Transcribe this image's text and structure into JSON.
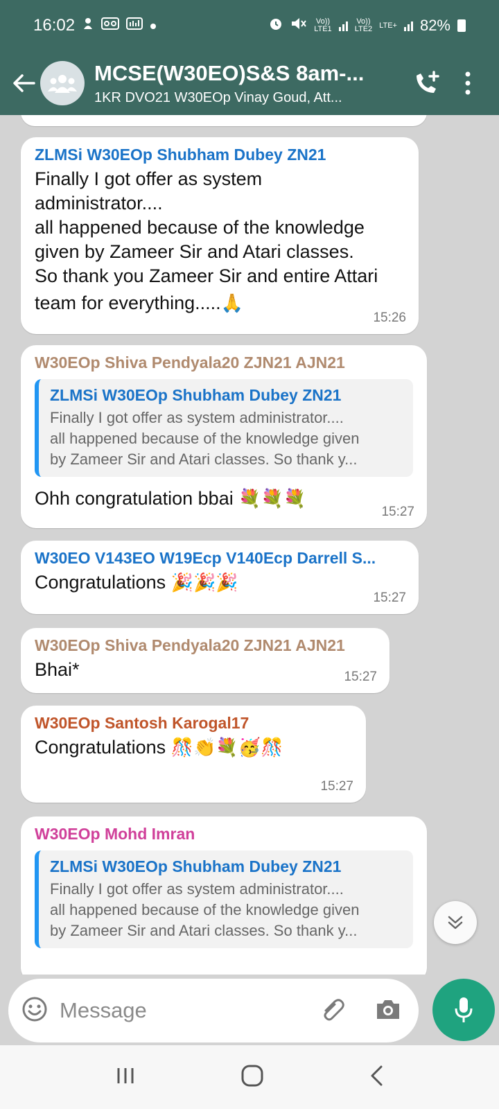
{
  "status_bar": {
    "time": "16:02",
    "sim1_label_top": "Vo))",
    "sim1_label_bottom": "LTE1",
    "sim2_label_top": "Vo))",
    "sim2_label_bottom": "LTE2",
    "network_type": "LTE+",
    "battery": "82%",
    "icons": [
      "notification-icon",
      "voicemail-icon",
      "signal-booster-icon",
      "dot-icon",
      "alarm-icon",
      "mute-icon",
      "signal-icon",
      "battery-icon"
    ]
  },
  "header": {
    "title": "MCSE(W30EO)S&S 8am-...",
    "subtitle": "1KR DVO21 W30EOp Vinay Goud, Att...",
    "icons": [
      "back-arrow-icon",
      "group-avatar-icon",
      "add-call-icon",
      "more-options-icon"
    ],
    "colors": {
      "header_bg": "#3d6a62"
    }
  },
  "messages": [
    {
      "sender": "ZLMSi W30EOp Shubham Dubey ZN21",
      "sender_color": "#1a73c8",
      "lines": [
        "Finally I got offer as system",
        "administrator....",
        "all happened because of the knowledge",
        "given by Zameer  Sir and Atari classes.",
        "So thank you Zameer Sir and entire Attari",
        "team for everything....."
      ],
      "emoji": "🙏",
      "time": "15:26"
    },
    {
      "sender": "W30EOp Shiva Pendyala20 ZJN21 AJN21",
      "sender_color": "#b08a6e",
      "quote": {
        "sender": "ZLMSi W30EOp Shubham Dubey ZN21",
        "lines": [
          "Finally I got offer as system administrator....",
          "all happened because of the knowledge given",
          "by Zameer  Sir and Atari classes. So thank y..."
        ]
      },
      "text": "Ohh congratulation bbai",
      "emoji": "💐💐💐",
      "time": "15:27"
    },
    {
      "sender": "W30EO V143EO W19Ecp V140Ecp Darrell S...",
      "sender_color": "#1a73c8",
      "text": "Congratulations",
      "emoji": "🎉🎉🎉",
      "time": "15:27"
    },
    {
      "sender": "W30EOp Shiva Pendyala20 ZJN21 AJN21",
      "sender_color": "#b08a6e",
      "text": "Bhai*",
      "time": "15:27"
    },
    {
      "sender": "W30EOp Santosh Karogal17",
      "sender_color": "#c0552a",
      "text": "Congratulations",
      "emoji": "🎊👏💐🥳🎊",
      "time": "15:27"
    },
    {
      "sender": "W30EOp Mohd Imran",
      "sender_color": "#d0409a",
      "quote": {
        "sender": "ZLMSi W30EOp Shubham Dubey ZN21",
        "lines": [
          "Finally I got offer as system administrator....",
          "all happened because of the knowledge given",
          "by Zameer  Sir and Atari classes. So thank y..."
        ]
      }
    }
  ],
  "input": {
    "placeholder": "Message",
    "icons": [
      "emoji-icon",
      "attach-icon",
      "camera-icon",
      "microphone-icon"
    ],
    "colors": {
      "mic_bg": "#1fa37f"
    }
  },
  "scroll_button": {
    "icon": "double-chevron-down-icon"
  },
  "nav_bar": {
    "icons": [
      "recent-apps-icon",
      "home-icon",
      "back-icon"
    ]
  }
}
